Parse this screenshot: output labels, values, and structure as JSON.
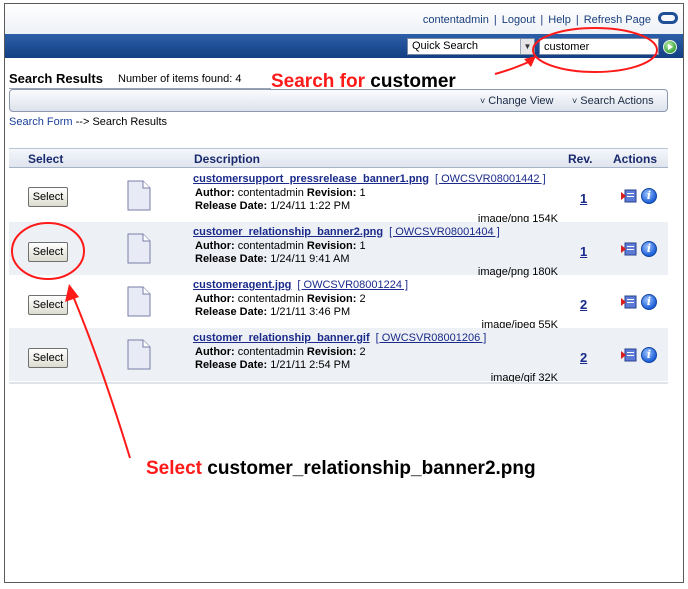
{
  "header": {
    "links": [
      {
        "label": "contentadmin",
        "name": "user-link"
      },
      {
        "label": "Logout",
        "name": "logout-link"
      },
      {
        "label": "Help",
        "name": "help-link"
      },
      {
        "label": "Refresh Page",
        "name": "refresh-page-link"
      }
    ],
    "brand_icon": "oracle-oval-logo"
  },
  "search": {
    "type_selected": "Quick Search",
    "query": "customer",
    "go_icon": "go-arrow-icon"
  },
  "results": {
    "title": "Search Results",
    "count_label": "Number of items found: 4",
    "actions": [
      {
        "label": "Change View"
      },
      {
        "label": "Search Actions"
      }
    ],
    "breadcrumb": {
      "link": "Search Form",
      "separator": "-->",
      "current": "Search Results"
    }
  },
  "table": {
    "headers": {
      "select": "Select",
      "description": "Description",
      "rev": "Rev.",
      "actions": "Actions"
    },
    "author_label": "Author:",
    "revision_label": "Revision:",
    "release_label": "Release Date:",
    "select_label": "Select",
    "rows": [
      {
        "filename": "customersupport_pressrelease_banner1.png",
        "id": "[ OWCSVR08001442 ]",
        "author": "contentadmin",
        "revision": "1",
        "release_date": "1/24/11 1:22 PM",
        "mime": "image/png 154K",
        "rev": "1"
      },
      {
        "filename": "customer_relationship_banner2.png",
        "id": "[ OWCSVR08001404 ]",
        "author": "contentadmin",
        "revision": "1",
        "release_date": "1/24/11 9:41 AM",
        "mime": "image/png 180K",
        "rev": "1"
      },
      {
        "filename": "customeragent.jpg",
        "id": "[ OWCSVR08001224 ]",
        "author": "contentadmin",
        "revision": "2",
        "release_date": "1/21/11 3:46 PM",
        "mime": "image/jpeg 55K",
        "rev": "2"
      },
      {
        "filename": "customer_relationship_banner.gif",
        "id": "[ OWCSVR08001206 ]",
        "author": "contentadmin",
        "revision": "2",
        "release_date": "1/21/11 2:54 PM",
        "mime": "image/gif 32K",
        "rev": "2"
      }
    ]
  },
  "annotations": {
    "search_prefix": "Search for",
    "search_term": "customer",
    "select_prefix": "Select",
    "select_term": "customer_relationship_banner2.png",
    "color": "#ff1a1a"
  }
}
